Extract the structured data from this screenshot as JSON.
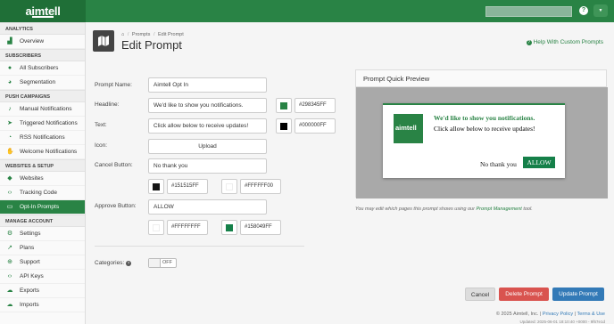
{
  "app": {
    "logo_text": "aimtell",
    "help_icon": "question-circle-icon",
    "user_menu_icon": "caret-down-icon"
  },
  "sidebar": {
    "sections": [
      {
        "title": "ANALYTICS",
        "items": [
          {
            "label": "Overview",
            "icon": "chart-icon"
          }
        ]
      },
      {
        "title": "SUBSCRIBERS",
        "items": [
          {
            "label": "All Subscribers",
            "icon": "users-icon"
          },
          {
            "label": "Segmentation",
            "icon": "pie-icon"
          }
        ]
      },
      {
        "title": "PUSH CAMPAIGNS",
        "items": [
          {
            "label": "Manual Notifications",
            "icon": "bell-icon"
          },
          {
            "label": "Triggered Notifications",
            "icon": "send-icon"
          },
          {
            "label": "RSS Notifications",
            "icon": "rss-icon"
          },
          {
            "label": "Welcome Notifications",
            "icon": "hand-icon"
          }
        ]
      },
      {
        "title": "WEBSITES & SETUP",
        "items": [
          {
            "label": "Websites",
            "icon": "globe-icon"
          },
          {
            "label": "Tracking Code",
            "icon": "code-icon"
          },
          {
            "label": "Opt-In Prompts",
            "icon": "window-icon",
            "active": true
          }
        ]
      },
      {
        "title": "MANAGE ACCOUNT",
        "items": [
          {
            "label": "Settings",
            "icon": "gear-icon"
          },
          {
            "label": "Plans",
            "icon": "line-chart-icon"
          },
          {
            "label": "Support",
            "icon": "lifebuoy-icon"
          },
          {
            "label": "API Keys",
            "icon": "code-icon"
          },
          {
            "label": "Exports",
            "icon": "cloud-download-icon"
          },
          {
            "label": "Imports",
            "icon": "cloud-upload-icon"
          }
        ]
      }
    ]
  },
  "page": {
    "breadcrumb": [
      "Prompts",
      "Edit Prompt"
    ],
    "title": "Edit Prompt",
    "help_link": "Help With Custom Prompts"
  },
  "form": {
    "prompt_name_label": "Prompt Name:",
    "prompt_name_value": "Aimtell Opt In",
    "headline_label": "Headline:",
    "headline_value": "We'd like to show you notifications.",
    "headline_color": "#298345FF",
    "text_label": "Text:",
    "text_value": "Click allow below to receive updates!",
    "text_color": "#000000FF",
    "icon_label": "Icon:",
    "upload_label": "Upload",
    "cancel_button_label": "Cancel Button:",
    "cancel_button_value": "No thank you",
    "cancel_text_color": "#151515FF",
    "cancel_bg_color": "#FFFFFF00",
    "approve_button_label": "Approve Button:",
    "approve_button_value": "ALLOW",
    "approve_text_color": "#FFFFFFFF",
    "approve_bg_color": "#158049FF",
    "categories_label": "Categories:",
    "categories_toggle": "OFF"
  },
  "colors": {
    "headline": "#298345",
    "text": "#000000",
    "cancel_text": "#151515",
    "cancel_bg": "#FFFFFF",
    "approve_text": "#FFFFFF",
    "approve_bg": "#158049"
  },
  "preview": {
    "title": "Prompt Quick Preview",
    "logo_text": "aimtell",
    "headline": "We'd like to show you notifications.",
    "text": "Click allow below to receive updates!",
    "cancel": "No thank you",
    "allow": "ALLOW",
    "note_prefix": "You may edit which pages this prompt shows using our ",
    "note_link": "Prompt Management",
    "note_suffix": " tool."
  },
  "actions": {
    "cancel": "Cancel",
    "delete": "Delete Prompt",
    "update": "Update Prompt"
  },
  "footer": {
    "copyright": "© 2025 Aimtell, Inc.",
    "privacy": "Privacy Policy",
    "terms": "Terms & Use",
    "updated": "Updated: 2025-06-01 18:10:40 +0000 - 9f67e1d"
  }
}
